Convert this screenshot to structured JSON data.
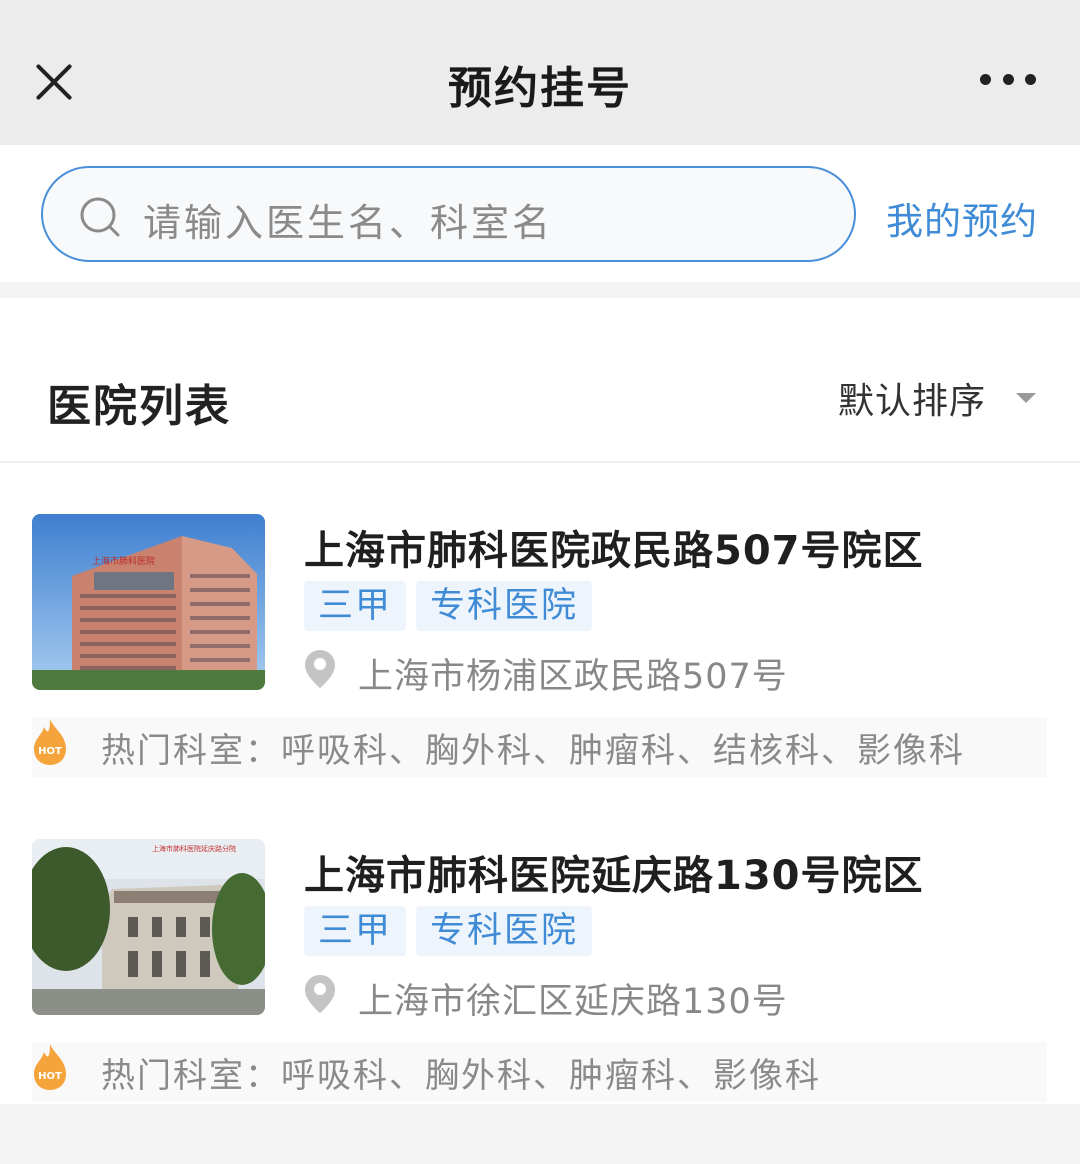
{
  "header": {
    "title": "预约挂号"
  },
  "search": {
    "placeholder": "请输入医生名、科室名",
    "my_appointments": "我的预约"
  },
  "list": {
    "title": "医院列表",
    "sort_label": "默认排序",
    "hospitals": [
      {
        "name": "上海市肺科医院政民路507号院区",
        "tags": [
          "三甲",
          "专科医院"
        ],
        "address": "上海市杨浦区政民路507号",
        "hot_departments": "热门科室：呼吸科、胸外科、肿瘤科、结核科、影像科",
        "photo_sign": "上海市肺科医院"
      },
      {
        "name": "上海市肺科医院延庆路130号院区",
        "tags": [
          "三甲",
          "专科医院"
        ],
        "address": "上海市徐汇区延庆路130号",
        "hot_departments": "热门科室：呼吸科、胸外科、肿瘤科、影像科",
        "photo_sign": "上海市肺科医院延庆路分院"
      }
    ]
  },
  "icons": {
    "close": "close-icon",
    "more": "more-icon",
    "search": "search-icon",
    "location": "location-pin-icon",
    "hot": "hot-flame-icon",
    "sort": "chevron-down-icon",
    "hot_badge_text": "HOT"
  },
  "colors": {
    "accent": "#3f8bd6",
    "tag_bg": "#eef4fb",
    "hot_orange": "#f5a33b",
    "header_bg": "#ececec"
  }
}
